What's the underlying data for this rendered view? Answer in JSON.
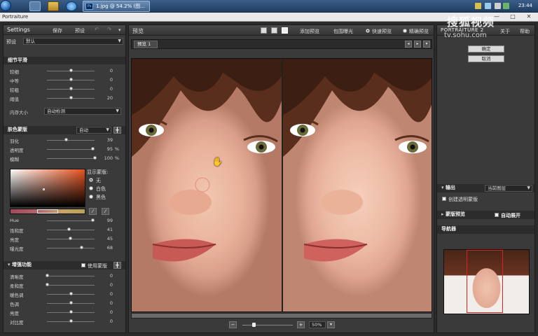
{
  "taskbar": {
    "active_task_label": "1.jpg @ 54.2% (图...",
    "clock": "23:44"
  },
  "window": {
    "app_title": "Portraiture",
    "minimize": "—",
    "maximize": "□",
    "close": "✕"
  },
  "watermark": {
    "main": "搜狐视频",
    "url": "tv.sohu.com"
  },
  "left_panel": {
    "title": "Settings",
    "save": "保存",
    "preset": "预设",
    "preset_label": "预设",
    "preset_value": "默认",
    "detail_section": {
      "title": "细节平滑",
      "sliders": [
        {
          "label": "较细",
          "value": 0,
          "pos": 0.5
        },
        {
          "label": "中等",
          "value": 0,
          "pos": 0.5
        },
        {
          "label": "较粗",
          "value": 0,
          "pos": 0.5
        },
        {
          "label": "阈值",
          "value": 20,
          "pos": 0.5
        }
      ],
      "size_label": "内存大小",
      "size_value": "自动检测"
    },
    "mask_section": {
      "title": "肤色蒙版",
      "mode": "自动",
      "pick_btn": "╋",
      "sliders": [
        {
          "label": "羽化",
          "value": "39",
          "unit": "",
          "pos": 0.4
        },
        {
          "label": "透明度",
          "value": "95",
          "unit": "%",
          "pos": 0.95
        },
        {
          "label": "模糊",
          "value": "100",
          "unit": "%",
          "pos": 1.0
        }
      ],
      "show_mask_label": "显示蒙版:",
      "radio_none": "无",
      "radio_white": "白色",
      "radio_black": "黑色",
      "hue_sliders": [
        {
          "label": "Hue",
          "value": 99,
          "pos": 0.95
        },
        {
          "label": "饱和度",
          "value": 41,
          "pos": 0.45
        },
        {
          "label": "亮度",
          "value": 45,
          "pos": 0.48
        },
        {
          "label": "曝光度",
          "value": 68,
          "pos": 0.72
        }
      ]
    },
    "enhance_section": {
      "title": "增强功能",
      "use_mask": "使用蒙版",
      "sliders": [
        {
          "label": "清晰度",
          "value": 0,
          "pos": 0.0
        },
        {
          "label": "柔和度",
          "value": 0,
          "pos": 0.0
        },
        {
          "label": "暖色调",
          "value": 0,
          "pos": 0.5
        },
        {
          "label": "色调",
          "value": 0,
          "pos": 0.5
        },
        {
          "label": "亮度",
          "value": 0,
          "pos": 0.5
        },
        {
          "label": "对比度",
          "value": 0,
          "pos": 0.5
        }
      ]
    }
  },
  "center": {
    "title": "预览",
    "add_preview": "添加预览",
    "surround_light": "包围曝光",
    "fast_preview": "快速预览",
    "accurate_preview": "精确预览",
    "tab_label": "预览 1",
    "zoom_value": "50%",
    "zoom_minus": "−",
    "zoom_plus": "+"
  },
  "right_panel": {
    "brand": "PORTRAITURE 2",
    "about": "关于",
    "help": "帮助",
    "ok": "确定",
    "cancel": "取消",
    "output_label": "输出",
    "output_value": "当前图层",
    "create_mask_layer": "创建透明蒙版",
    "mask_preview": "蒙版预览",
    "auto_expand": "自动展开",
    "navigator": "导航器"
  },
  "colors": {
    "accent": "#c8392b",
    "panel": "#3a3a3a"
  }
}
